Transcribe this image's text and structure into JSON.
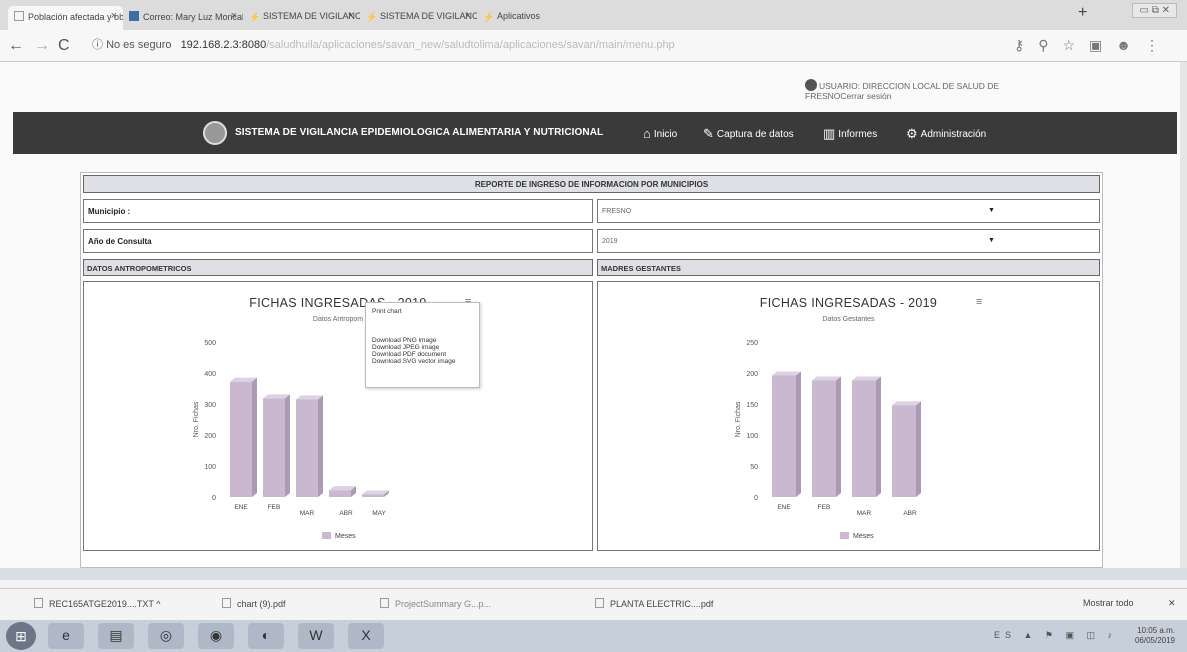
{
  "browser": {
    "tabs": [
      {
        "label": "Población afectada y objetivo -"
      },
      {
        "label": "Correo: Mary Luz Moncaleano"
      },
      {
        "label": "SISTEMA DE VIGILANCIA EPIE"
      },
      {
        "label": "SISTEMA DE VIGILANCIA EPIE"
      },
      {
        "label": "Aplicativos"
      }
    ],
    "new_tab": "+",
    "insecure_label": "No es seguro",
    "url_host": "192.168.2.3:8080",
    "url_path": "/saludhuila/aplicaciones/savan_new/saludtolima/aplicaciones/savan/main/menu.php"
  },
  "header": {
    "user_prefix": "USUARIO: DIRECCION LOCAL DE SALUD DE",
    "user_suffix": "FRESNO",
    "logout": "Cerrar sesión",
    "system_title": "SISTEMA DE VIGILANCIA EPIDEMIOLOGICA ALIMENTARIA Y NUTRICIONAL",
    "menu": {
      "inicio": "Inicio",
      "captura": "Captura de datos",
      "informes": "Informes",
      "admin": "Administración"
    }
  },
  "form": {
    "report_title": "REPORTE DE INGRESO DE INFORMACION POR MUNICIPIOS",
    "municipio_label": "Municipio :",
    "municipio_value": "FRESNO",
    "anio_label": "Año de Consulta",
    "anio_value": "2019",
    "section_left": "DATOS ANTROPOMETRICOS",
    "section_right": "MADRES GESTANTES"
  },
  "context_menu": {
    "print": "Print chart",
    "png": "Download PNG image",
    "jpeg": "Download JPEG image",
    "pdf": "Download PDF document",
    "svg": "Download SVG vector image"
  },
  "chart_data": [
    {
      "type": "bar",
      "title": "FICHAS INGRESADAS - 2019",
      "subtitle": "Datos Antropom",
      "ylabel": "Nro. Fichas",
      "legend": "Meses",
      "categories": [
        "ENE",
        "FEB",
        "MAR",
        "ABR",
        "MAY"
      ],
      "series": [
        {
          "name": "Meses",
          "values": [
            372,
            318,
            315,
            22,
            8
          ]
        }
      ],
      "ylim": [
        0,
        500
      ],
      "yticks": [
        0,
        100,
        200,
        300,
        400,
        500
      ],
      "color": "#c9b8cf"
    },
    {
      "type": "bar",
      "title": "FICHAS INGRESADAS - 2019",
      "subtitle": "Datos Gestantes",
      "ylabel": "Nro. Fichas",
      "legend": "Meses",
      "categories": [
        "ENE",
        "FEB",
        "MAR",
        "ABR"
      ],
      "series": [
        {
          "name": "Meses",
          "values": [
            196,
            188,
            188,
            148
          ]
        }
      ],
      "ylim": [
        0,
        250
      ],
      "yticks": [
        0,
        50,
        100,
        150,
        200,
        250
      ],
      "color": "#c9b8cf"
    }
  ],
  "downloads": [
    {
      "name": "REC165ATGE2019....TXT"
    },
    {
      "name": "chart (9).pdf"
    },
    {
      "name": "ProjectSummary G...p..."
    },
    {
      "name": "PLANTA ELECTRIC....pdf"
    }
  ],
  "downloads_show_all": "Mostrar todo",
  "taskbar": {
    "lang": "ES",
    "time": "10:05 a.m.",
    "date": "06/05/2019"
  }
}
